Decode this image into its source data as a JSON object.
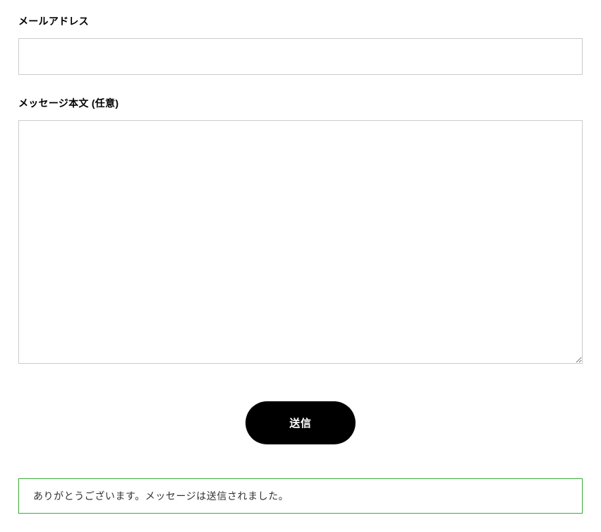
{
  "form": {
    "email": {
      "label": "メールアドレス",
      "value": ""
    },
    "message": {
      "label": "メッセージ本文 (任意)",
      "value": ""
    },
    "submit": {
      "label": "送信"
    }
  },
  "status": {
    "success_message": "ありがとうございます。メッセージは送信されました。"
  }
}
